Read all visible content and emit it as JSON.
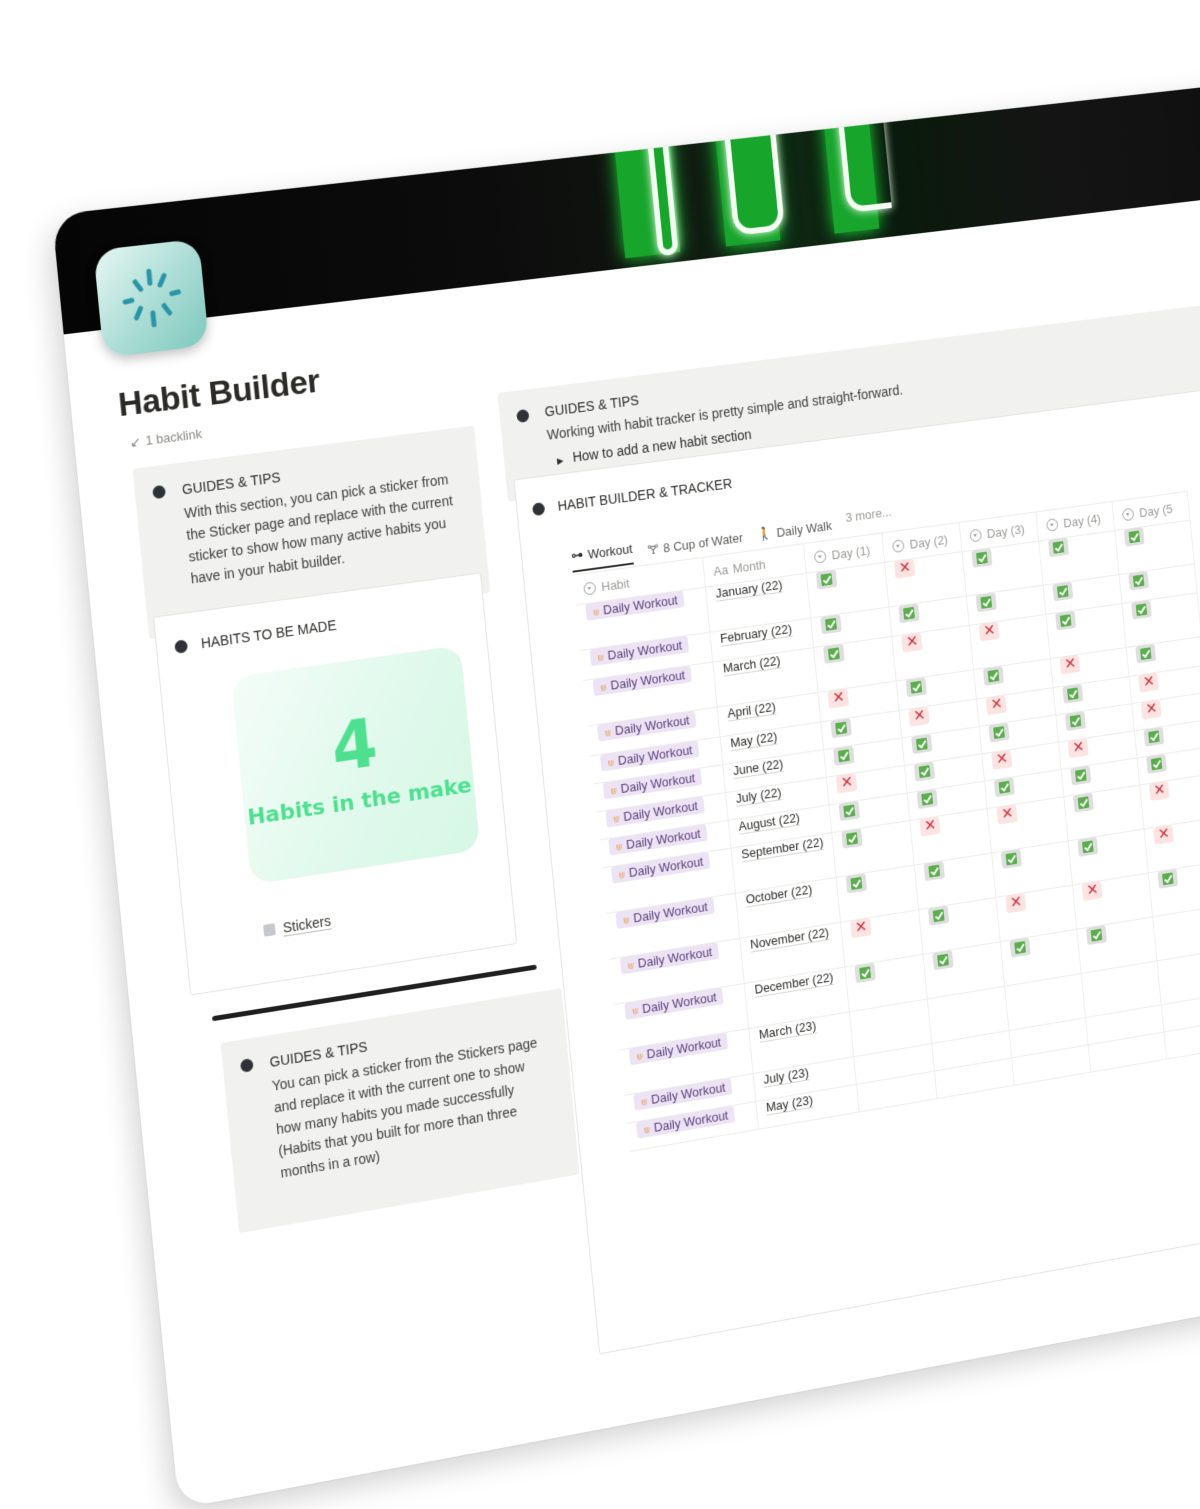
{
  "page": {
    "title": "Habit Builder",
    "backlinks": "1 backlink",
    "icon": "loading-spinner-icon"
  },
  "left": {
    "callout1": {
      "heading": "GUIDES & TIPS",
      "body": "With this section, you can pick a sticker from the Sticker page and replace with the current sticker to show how many active habits you have in your habit builder."
    },
    "habits_box": {
      "heading": "HABITS TO BE MADE",
      "sticker_number": "4",
      "sticker_caption": "Habits in the make",
      "link_label": "Stickers"
    },
    "callout2": {
      "heading": "GUIDES & TIPS",
      "body": "You can pick a sticker from the Stickers page and replace it with the current one to show how many habits you made successfully (Habits that you built for more than three months in a row)"
    }
  },
  "right": {
    "callout": {
      "heading": "GUIDES & TIPS",
      "body": "Working with habit tracker is pretty simple and straight-forward.",
      "toggle": "How to add a new habit section"
    },
    "tracker": {
      "heading": "HABIT BUILDER & TRACKER",
      "views": [
        {
          "label": "Workout",
          "icon": "dumbbell-icon",
          "active": true
        },
        {
          "label": "8 Cup of Water",
          "icon": "cup-icon",
          "active": false
        },
        {
          "label": "Daily Walk",
          "icon": "walking-person-icon",
          "active": false
        }
      ],
      "more_views": "3 more...",
      "columns": {
        "habit": "Habit",
        "month": "Month",
        "month_prefix": "Aa",
        "days": [
          "Day (1)",
          "Day (2)",
          "Day (3)",
          "Day (4)",
          "Day (5"
        ]
      },
      "rows": [
        {
          "habit": "Daily Workout",
          "month": "January (22)",
          "days": [
            "yes",
            "no",
            "yes",
            "yes",
            "yes"
          ]
        },
        {
          "habit": "Daily Workout",
          "month": "February (22)",
          "days": [
            "yes",
            "yes",
            "yes",
            "yes",
            "yes"
          ]
        },
        {
          "habit": "Daily Workout",
          "month": "March (22)",
          "days": [
            "yes",
            "no",
            "no",
            "yes",
            "yes"
          ]
        },
        {
          "habit": "Daily Workout",
          "month": "April (22)",
          "days": [
            "no",
            "yes",
            "yes",
            "no",
            "yes"
          ]
        },
        {
          "habit": "Daily Workout",
          "month": "May (22)",
          "days": [
            "yes",
            "no",
            "no",
            "yes",
            "no"
          ]
        },
        {
          "habit": "Daily Workout",
          "month": "June (22)",
          "days": [
            "yes",
            "yes",
            "yes",
            "yes",
            "no"
          ]
        },
        {
          "habit": "Daily Workout",
          "month": "July (22)",
          "days": [
            "no",
            "yes",
            "no",
            "no",
            "yes"
          ]
        },
        {
          "habit": "Daily Workout",
          "month": "August (22)",
          "days": [
            "yes",
            "yes",
            "yes",
            "yes",
            "yes"
          ]
        },
        {
          "habit": "Daily Workout",
          "month": "September (22)",
          "days": [
            "yes",
            "no",
            "no",
            "yes",
            "no"
          ]
        },
        {
          "habit": "Daily Workout",
          "month": "October (22)",
          "days": [
            "yes",
            "yes",
            "yes",
            "yes",
            "no"
          ]
        },
        {
          "habit": "Daily Workout",
          "month": "November (22)",
          "days": [
            "no",
            "yes",
            "no",
            "no",
            "yes"
          ]
        },
        {
          "habit": "Daily Workout",
          "month": "December (22)",
          "days": [
            "yes",
            "yes",
            "yes",
            "yes",
            ""
          ]
        },
        {
          "habit": "Daily Workout",
          "month": "March (23)",
          "days": [
            "",
            "",
            "",
            "",
            ""
          ]
        },
        {
          "habit": "Daily Workout",
          "month": "July (23)",
          "days": [
            "",
            "",
            "",
            "",
            ""
          ]
        },
        {
          "habit": "Daily Workout",
          "month": "May (23)",
          "days": [
            "",
            "",
            "",
            "",
            ""
          ]
        }
      ]
    }
  },
  "colors": {
    "sticker_green": "#4fe08f",
    "check_green": "#5aae4c",
    "cross_red": "#d32f3d",
    "tag_bg": "#ece3f5",
    "callout_bg": "#f1f1ef"
  }
}
